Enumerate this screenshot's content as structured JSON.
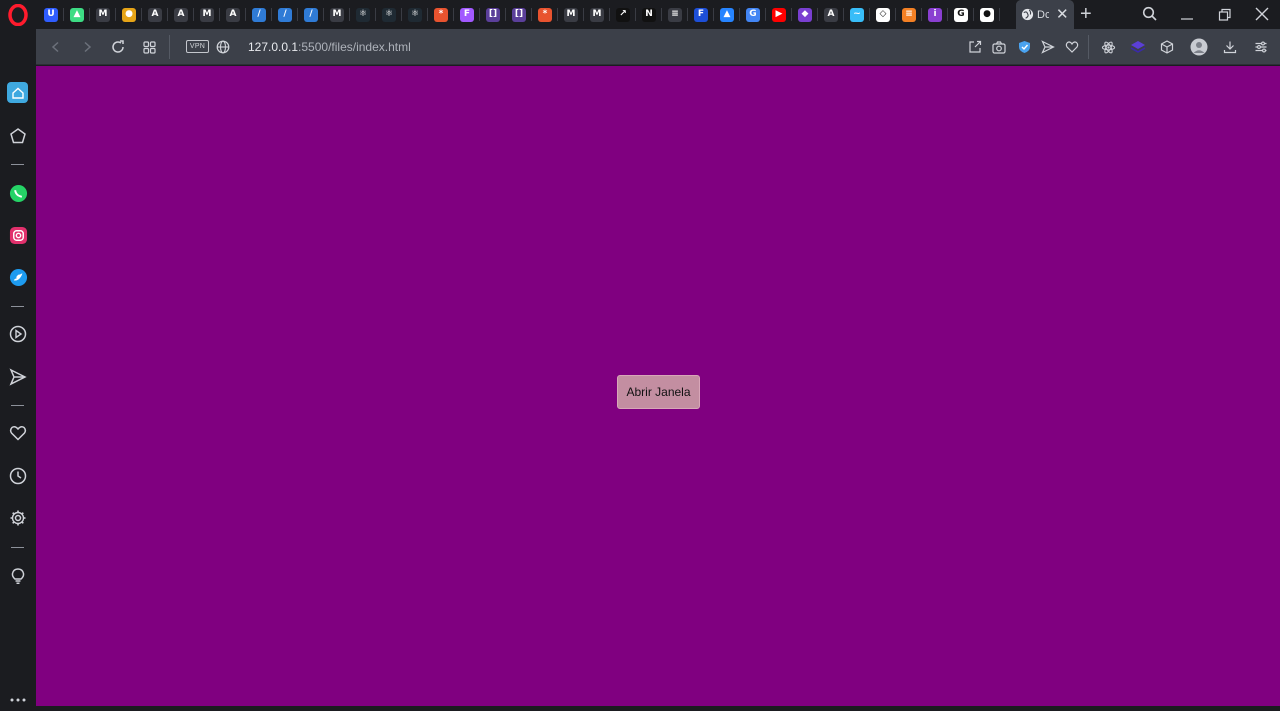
{
  "browser": {
    "active_tab_title": "Dc",
    "url_host": "127.0.0.1",
    "url_rest": ":5500/files/index.html",
    "vpn_label": "VPN"
  },
  "tabs": [
    {
      "icon": "uniswap-icon",
      "glyph": "U",
      "color": "#2f5dff"
    },
    {
      "icon": "android-icon",
      "glyph": "▲",
      "color": "#3ddc84"
    },
    {
      "icon": "medium-icon",
      "glyph": "M",
      "color": "#3a3c44"
    },
    {
      "icon": "medal-icon",
      "glyph": "●",
      "color": "#e6a417"
    },
    {
      "icon": "angular-bracket-icon",
      "glyph": "A",
      "color": "#3a3c44"
    },
    {
      "icon": "angular-bracket-icon",
      "glyph": "A",
      "color": "#3a3c44"
    },
    {
      "icon": "medium-icon",
      "glyph": "M",
      "color": "#3a3c44"
    },
    {
      "icon": "angular-bracket-icon",
      "glyph": "A",
      "color": "#3a3c44"
    },
    {
      "icon": "vercel-slash-icon",
      "glyph": "/",
      "color": "#2f7bd6"
    },
    {
      "icon": "vercel-slash-icon",
      "glyph": "/",
      "color": "#2f7bd6"
    },
    {
      "icon": "vercel-slash-icon",
      "glyph": "/",
      "color": "#2f7bd6"
    },
    {
      "icon": "medium-icon",
      "glyph": "M",
      "color": "#3a3c44"
    },
    {
      "icon": "react-icon",
      "glyph": "⚛",
      "color": "#1f2a33"
    },
    {
      "icon": "react-icon",
      "glyph": "⚛",
      "color": "#1f2a33"
    },
    {
      "icon": "react-icon",
      "glyph": "⚛",
      "color": "#1f2a33"
    },
    {
      "icon": "asterisk-icon",
      "glyph": "*",
      "color": "#e8532f"
    },
    {
      "icon": "figma-icon",
      "glyph": "F",
      "color": "#a259ff"
    },
    {
      "icon": "bracket-icon",
      "glyph": "[]",
      "color": "#5b3f9a"
    },
    {
      "icon": "bracket-icon",
      "glyph": "[]",
      "color": "#5b3f9a"
    },
    {
      "icon": "asterisk-icon",
      "glyph": "*",
      "color": "#e8532f"
    },
    {
      "icon": "medium-icon",
      "glyph": "M",
      "color": "#3a3c44"
    },
    {
      "icon": "medium-icon",
      "glyph": "M",
      "color": "#3a3c44"
    },
    {
      "icon": "arrow-icon",
      "glyph": "↗",
      "color": "#111111"
    },
    {
      "icon": "notion-icon",
      "glyph": "N",
      "color": "#111111"
    },
    {
      "icon": "document-icon",
      "glyph": "≡",
      "color": "#3a3c44"
    },
    {
      "icon": "framer-icon",
      "glyph": "F",
      "color": "#1d4fd8"
    },
    {
      "icon": "atlassian-icon",
      "glyph": "▲",
      "color": "#2684ff"
    },
    {
      "icon": "google-icon",
      "glyph": "G",
      "color": "#4285f4"
    },
    {
      "icon": "youtube-icon",
      "glyph": "▶",
      "color": "#ff0000"
    },
    {
      "icon": "shield-icon",
      "glyph": "◆",
      "color": "#7a3fd1"
    },
    {
      "icon": "angular-bracket-icon",
      "glyph": "A",
      "color": "#3a3c44"
    },
    {
      "icon": "tailwind-icon",
      "glyph": "~",
      "color": "#38bdf8"
    },
    {
      "icon": "codepen-icon",
      "glyph": "◇",
      "color": "#ffffff"
    },
    {
      "icon": "stackoverflow-icon",
      "glyph": "≡",
      "color": "#f48024"
    },
    {
      "icon": "info-icon",
      "glyph": "i",
      "color": "#8a3fd1"
    },
    {
      "icon": "google-icon",
      "glyph": "G",
      "color": "#ffffff"
    },
    {
      "icon": "github-icon",
      "glyph": "●",
      "color": "#ffffff"
    }
  ],
  "sidebar": {
    "items": [
      {
        "name": "home-icon"
      },
      {
        "name": "speed-dial-icon"
      },
      {
        "name": "whatsapp-icon"
      },
      {
        "name": "instagram-icon"
      },
      {
        "name": "twitter-icon"
      },
      {
        "name": "player-icon"
      },
      {
        "name": "send-icon"
      },
      {
        "name": "heart-icon"
      },
      {
        "name": "history-icon"
      },
      {
        "name": "settings-icon"
      },
      {
        "name": "lightbulb-icon"
      },
      {
        "name": "more-icon"
      }
    ]
  },
  "page": {
    "background": "#800080",
    "button_label": "Abrir Janela"
  }
}
